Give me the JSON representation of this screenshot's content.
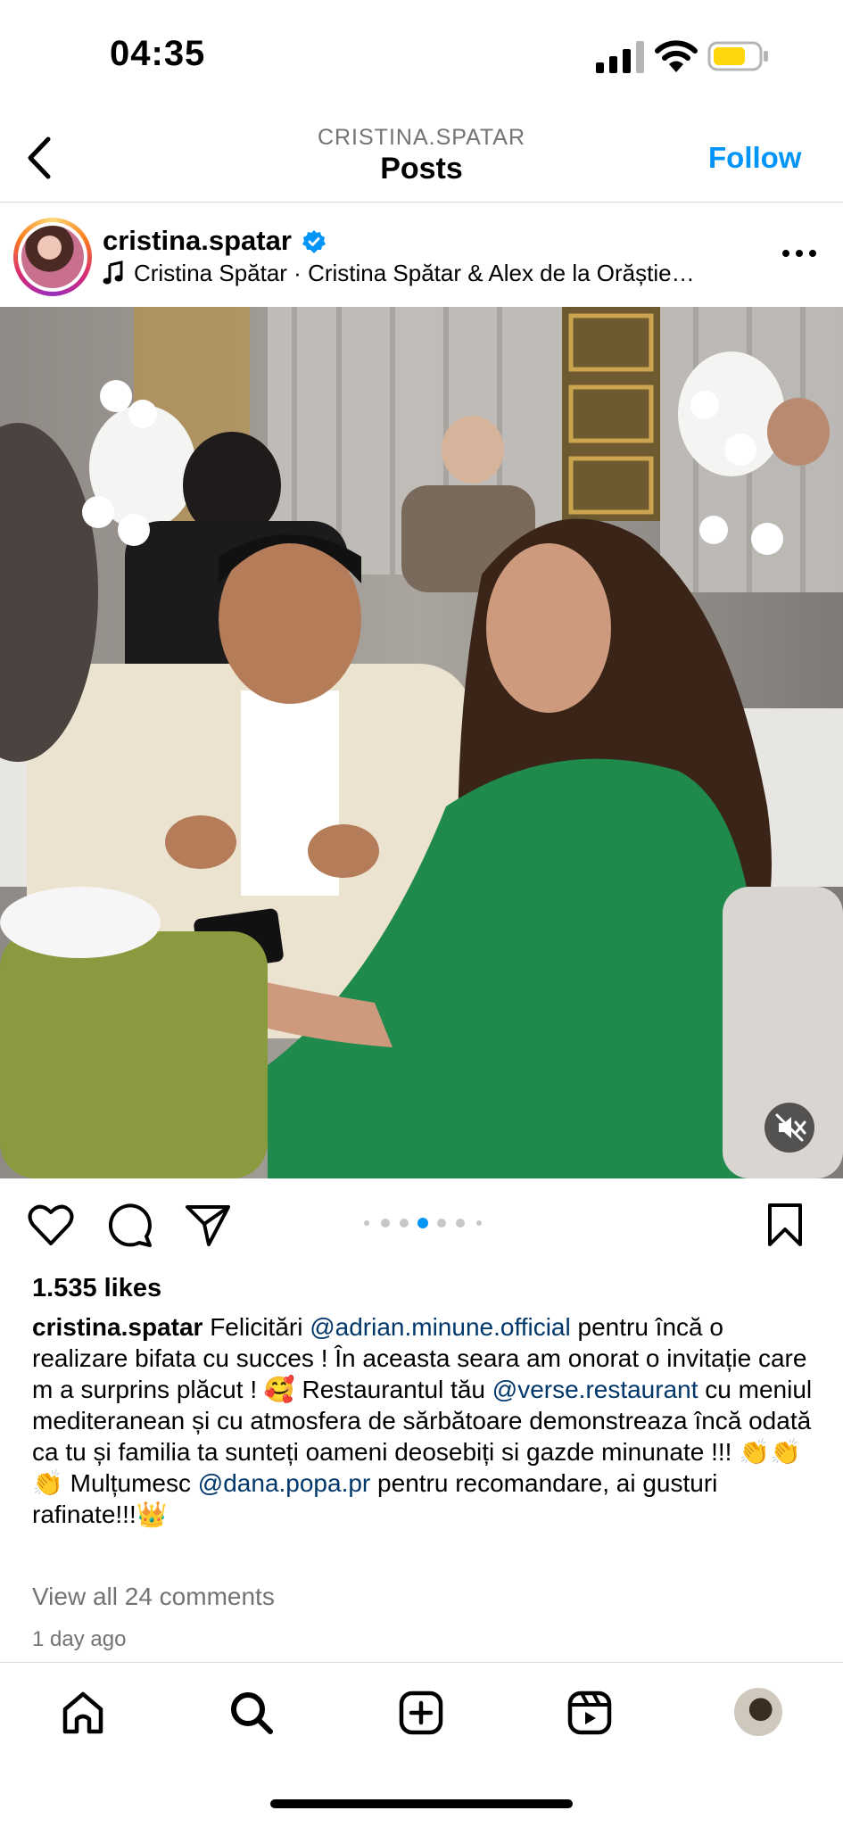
{
  "status_bar": {
    "time": "04:35"
  },
  "header": {
    "username": "CRISTINA.SPATAR",
    "title": "Posts",
    "follow_label": "Follow"
  },
  "post": {
    "username": "cristina.spatar",
    "audio": "Cristina Spătar · Cristina Spătar & Alex de la Orăștie…",
    "likes": "1.535 likes",
    "caption": {
      "username": "cristina.spatar",
      "t1": " Felicitări  ",
      "m1": "@adrian.minune.official",
      "t2": "  pentru încă o realizare bifata cu succes ! În aceasta seara am onorat o invitație care m a surprins plăcut ! 🥰 Restaurantul tău ",
      "m2": "@verse.restaurant",
      "t3": "  cu meniul mediteranean și cu atmosfera de sărbătoare  demonstreaza încă odată ca tu și familia ta sunteți oameni deosebiți si gazde minunate !!! 👏👏👏 Mulțumesc ",
      "m3": "@dana.popa.pr",
      "t4": " pentru recomandare, ai gusturi rafinate!!!👑"
    },
    "comments_link": "View all 24 comments",
    "time_ago": "1 day ago",
    "carousel": {
      "total": 7,
      "active": 4
    }
  },
  "icons": {
    "back": "chevron-left-icon",
    "verified": "verified-badge-icon",
    "music": "music-note-icon",
    "more": "more-icon",
    "mute": "speaker-muted-icon",
    "like": "heart-icon",
    "comment": "comment-icon",
    "share": "paper-plane-icon",
    "save": "bookmark-icon",
    "home": "home-icon",
    "search": "search-icon",
    "create": "plus-square-icon",
    "reels": "reels-icon"
  },
  "colors": {
    "accent": "#0095f6",
    "mention": "#00376b",
    "muted_text": "#737373",
    "battery": "#ffd60a"
  }
}
